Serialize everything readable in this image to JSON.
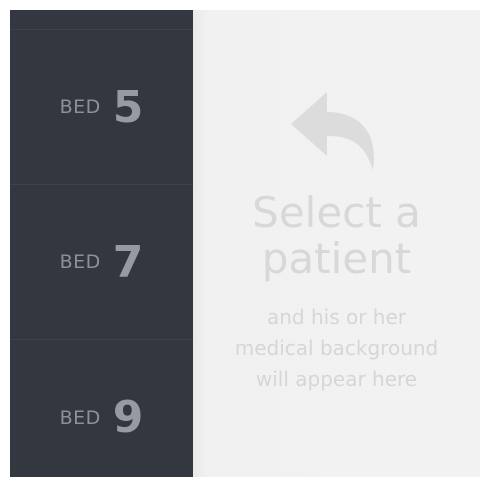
{
  "sidebar": {
    "beds": [
      {
        "label": "BED",
        "number": "5"
      },
      {
        "label": "BED",
        "number": "7"
      },
      {
        "label": "BED",
        "number": "9"
      }
    ]
  },
  "placeholder": {
    "icon": "reply-arrow-icon",
    "headline_line1": "Select a",
    "headline_line2": "patient",
    "subtext_line1": "and his or her",
    "subtext_line2": "medical background",
    "subtext_line3": "will appear here"
  },
  "colors": {
    "sidebar_bg": "#323740",
    "content_bg": "#f2f2f2",
    "placeholder_text": "#d8d8d8"
  }
}
